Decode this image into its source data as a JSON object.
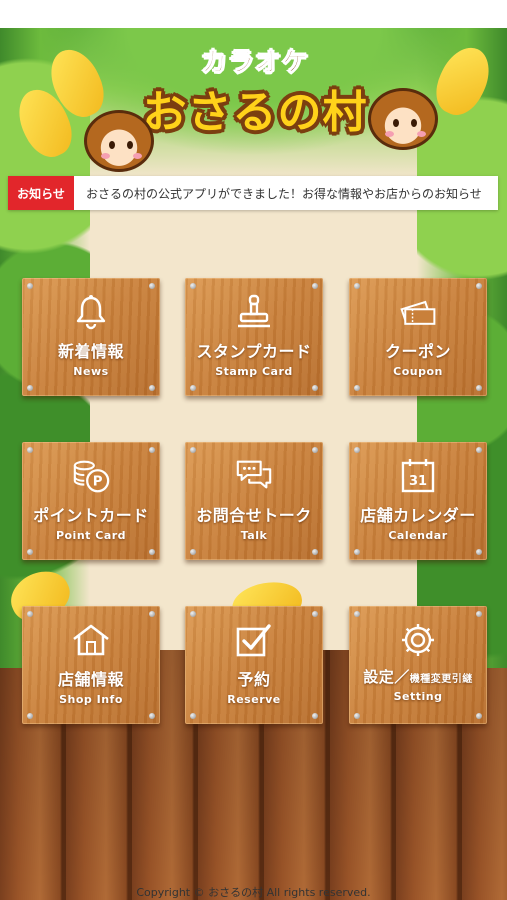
{
  "header": {
    "sub_title": "カラオケ",
    "main_title": "おさるの村"
  },
  "ticker": {
    "label": "お知らせ",
    "text": "おさるの村の公式アプリができました！お得な情報やお店からのお知らせ"
  },
  "menu": [
    {
      "ja": "新着情報",
      "en": "News",
      "icon": "bell-icon"
    },
    {
      "ja": "スタンプカード",
      "en": "Stamp Card",
      "icon": "stamp-icon"
    },
    {
      "ja": "クーポン",
      "en": "Coupon",
      "icon": "coupon-icon"
    },
    {
      "ja": "ポイントカード",
      "en": "Point Card",
      "icon": "coins-icon"
    },
    {
      "ja": "お問合せトーク",
      "en": "Talk",
      "icon": "chat-icon"
    },
    {
      "ja": "店舗カレンダー",
      "en": "Calendar",
      "icon": "calendar-icon",
      "calendar_day": "31"
    },
    {
      "ja": "店舗情報",
      "en": "Shop Info",
      "icon": "house-icon"
    },
    {
      "ja": "予約",
      "en": "Reserve",
      "icon": "checkbox-icon"
    },
    {
      "ja": "設定／",
      "ja_small": "機種変更引継",
      "en": "Setting",
      "icon": "gear-icon"
    }
  ],
  "footer": {
    "copyright": "Copyright © おさるの村 All rights reserved."
  },
  "colors": {
    "ticker_label_bg": "#e2262b",
    "tile_wood": "#c9803a",
    "logo_yellow": "#ffd21a",
    "logo_brown": "#7b3f10"
  }
}
